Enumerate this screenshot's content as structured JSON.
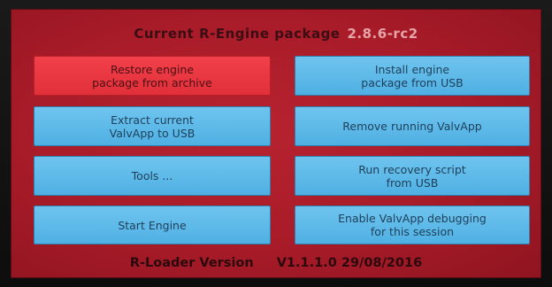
{
  "header": {
    "title": "Current R-Engine package",
    "version": "2.8.6-rc2"
  },
  "buttons": {
    "restore": "Restore engine\npackage from archive",
    "install": "Install engine\npackage from USB",
    "extract": "Extract current\nValvApp to USB",
    "remove": "Remove running ValvApp",
    "tools": "Tools ...",
    "recovery": "Run  recovery script\nfrom USB",
    "start": "Start Engine",
    "debug": "Enable ValvApp debugging\nfor this session"
  },
  "footer": {
    "label": "R-Loader Version",
    "version": "V1.1.1.0 29/08/2016"
  },
  "colors": {
    "background": "#a81b28",
    "button": "#5bb8e8",
    "button_selected": "#e8353f"
  }
}
